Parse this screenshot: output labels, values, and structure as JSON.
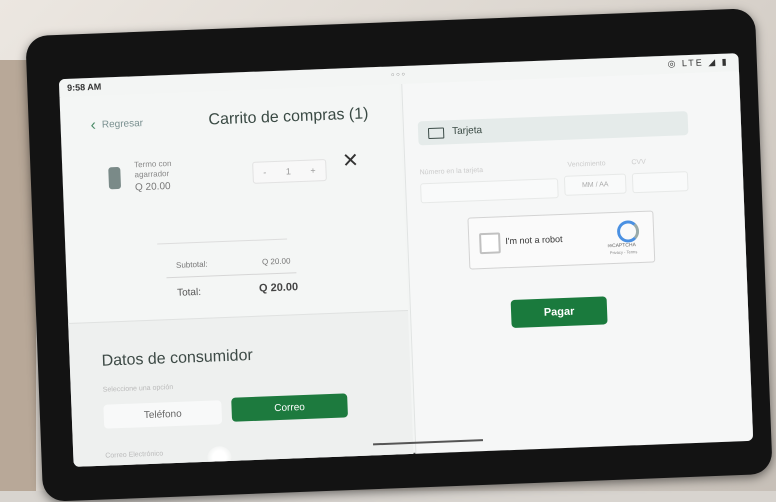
{
  "status_bar": {
    "time": "9:58 AM",
    "icons": "⚙ ◆ •",
    "right_icons": "◎ LTE ◢ ▮",
    "camera": "○ ○ ○"
  },
  "cart": {
    "back_label": "Regresar",
    "title": "Carrito de compras (1)",
    "product": {
      "name": "Termo con agarrador",
      "price": "Q 20.00",
      "quantity": "1",
      "minus": "-",
      "plus": "+"
    },
    "remove_icon": "✕",
    "subtotal_label": "Subtotal:",
    "subtotal_value": "Q 20.00",
    "total_label": "Total:",
    "total_value": "Q 20.00"
  },
  "consumer": {
    "title": "Datos de consumidor",
    "hint": "Seleccione una opción",
    "phone_button": "Teléfono",
    "email_button": "Correo",
    "email_label": "Correo Electrónico"
  },
  "payment": {
    "card_label": "Tarjeta",
    "card_number_label": "Número en la tarjeta",
    "expiry_label": "Vencimiento",
    "expiry_placeholder": "MM / AA",
    "cvv_label": "CVV",
    "captcha_text": "I'm not a robot",
    "captcha_brand": "reCAPTCHA",
    "captcha_terms": "Privacy - Terms",
    "pay_button": "Pagar"
  },
  "colors": {
    "accent_green": "#1d7a3e",
    "card_header_bg": "#e5ebea"
  }
}
